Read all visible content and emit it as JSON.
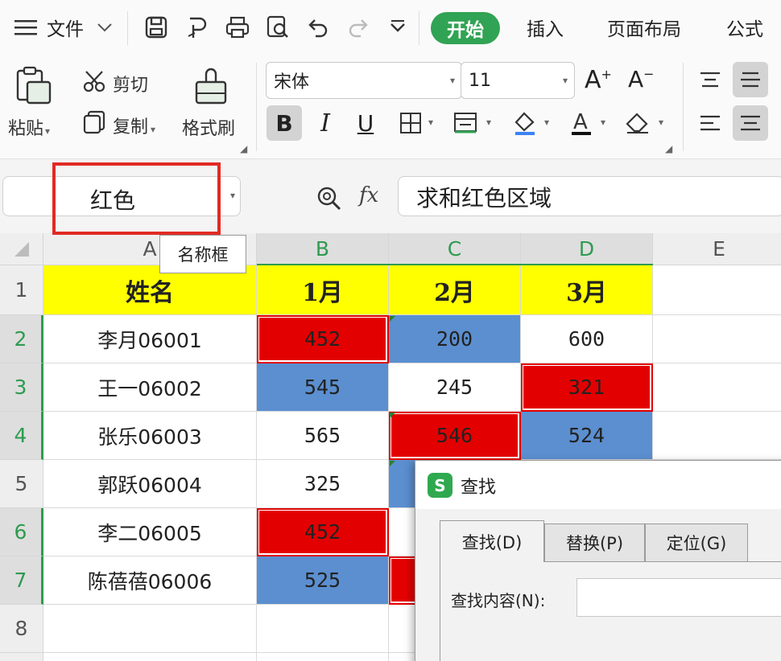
{
  "menubar": {
    "menu_label": "文件",
    "tabs": [
      "开始",
      "插入",
      "页面布局",
      "公式"
    ]
  },
  "ribbon": {
    "paste": "粘贴",
    "cut": "剪切",
    "copy": "复制",
    "format_painter": "格式刷",
    "font_name": "宋体",
    "font_size": "11",
    "bold": "B",
    "italic": "I",
    "underline": "U"
  },
  "formula_bar": {
    "name_box_value": "红色",
    "fx_label": "fx",
    "formula_value": "求和红色区域",
    "tooltip": "名称框"
  },
  "grid": {
    "columns": [
      "A",
      "B",
      "C",
      "D",
      "E"
    ],
    "rows": [
      "1",
      "2",
      "3",
      "4",
      "5",
      "6",
      "7",
      "8"
    ],
    "header": [
      "姓名",
      "1月",
      "2月",
      "3月"
    ],
    "data": [
      {
        "name": "李月06001",
        "jan": "452",
        "feb": "200",
        "mar": "600"
      },
      {
        "name": "王一06002",
        "jan": "545",
        "feb": "245",
        "mar": "321"
      },
      {
        "name": "张乐06003",
        "jan": "565",
        "feb": "546",
        "mar": "524"
      },
      {
        "name": "郭跃06004",
        "jan": "325"
      },
      {
        "name": "李二06005",
        "jan": "452"
      },
      {
        "name": "陈蓓蓓06006",
        "jan": "525"
      }
    ],
    "fill_colors": {
      "red": "#e30000",
      "blue": "#5b8fd0",
      "header_yellow": "#ffff00"
    }
  },
  "dialog": {
    "title": "查找",
    "tabs": [
      "查找(D)",
      "替换(P)",
      "定位(G)"
    ],
    "find_label": "查找内容(N):"
  },
  "colors": {
    "accent_green": "#31a354",
    "highlight_red": "#e12a24"
  }
}
